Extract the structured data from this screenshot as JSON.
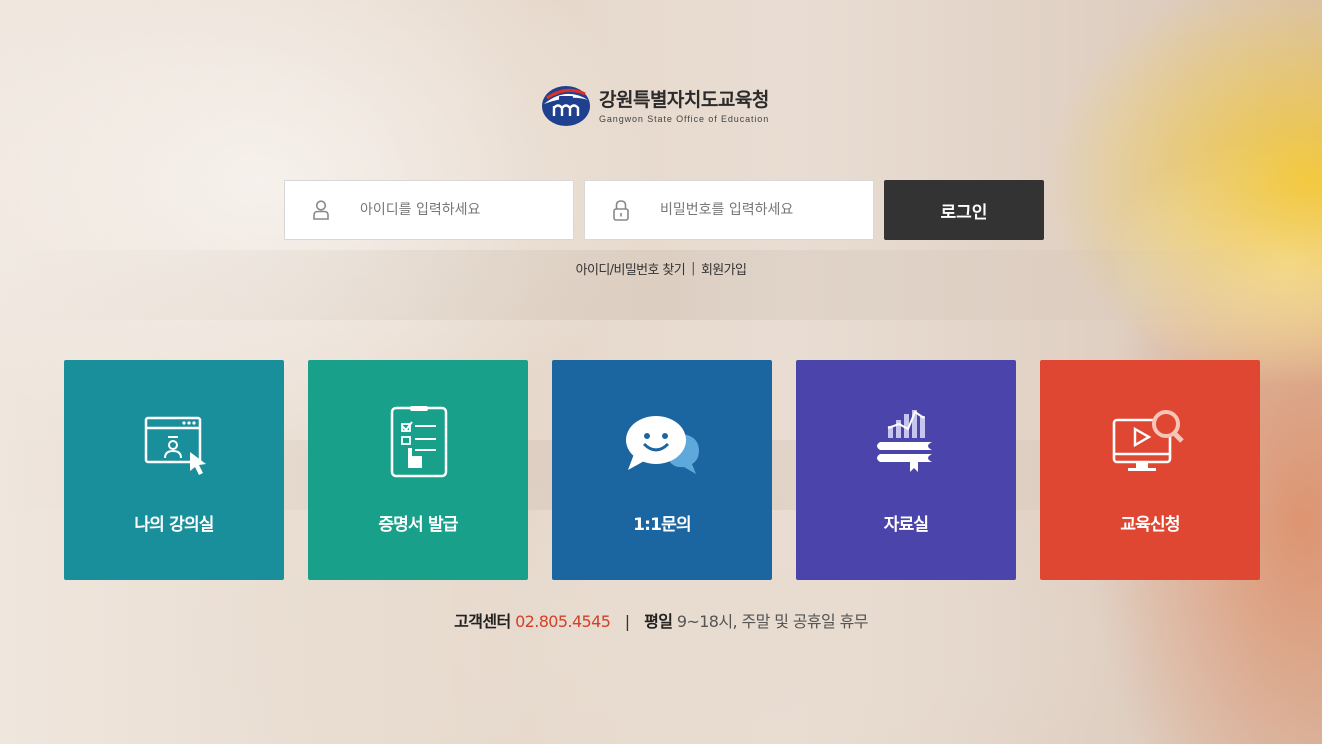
{
  "logo": {
    "title": "강원특별자치도교육청",
    "subtitle": "Gangwon State Office of Education",
    "emblem_icon": "gangwon-emblem-icon"
  },
  "login": {
    "id_placeholder": "아이디를 입력하세요",
    "pw_placeholder": "비밀번호를 입력하세요",
    "button_label": "로그인",
    "id_icon": "user-icon",
    "pw_icon": "lock-icon"
  },
  "links": {
    "find": "아이디/비밀번호 찾기",
    "separator": "|",
    "join": "회원가입"
  },
  "menu": [
    {
      "label": "나의 강의실",
      "icon": "classroom-icon",
      "color": "#1a8f9c"
    },
    {
      "label": "증명서 발급",
      "icon": "certificate-icon",
      "color": "#18a08b"
    },
    {
      "label": "1:1문의",
      "icon": "chat-icon",
      "color": "#1b66a1"
    },
    {
      "label": "자료실",
      "icon": "library-icon",
      "color": "#4b44ab"
    },
    {
      "label": "교육신청",
      "icon": "education-apply-icon",
      "color": "#df4733"
    }
  ],
  "support": {
    "center_label": "고객센터",
    "phone": "02.805.4545",
    "separator": "|",
    "weekday_label": "평일",
    "hours": "9~18시, 주말 및 공휴일 휴무"
  },
  "colors": {
    "accent_phone": "#d2412a",
    "login_button": "#333333"
  }
}
